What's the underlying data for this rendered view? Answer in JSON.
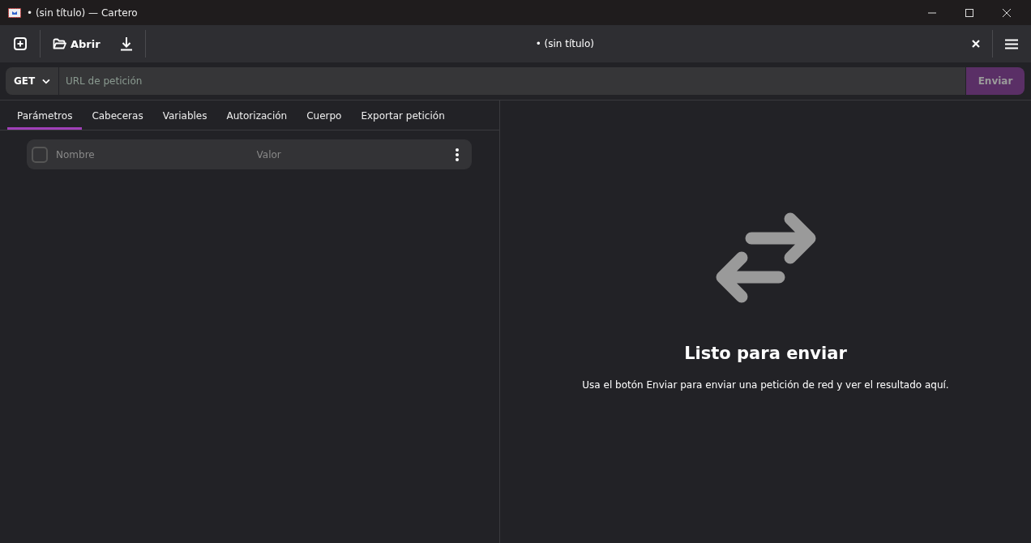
{
  "window": {
    "title": "• (sin título) — Cartero"
  },
  "header": {
    "open_label": "Abrir",
    "document_title": "• (sin título)"
  },
  "request": {
    "method": "GET",
    "url_placeholder": "URL de petición",
    "send_label": "Enviar",
    "send_disabled": true
  },
  "tabs": [
    {
      "label": "Parámetros",
      "selected": true
    },
    {
      "label": "Cabeceras",
      "selected": false
    },
    {
      "label": "Variables",
      "selected": false
    },
    {
      "label": "Autorización",
      "selected": false
    },
    {
      "label": "Cuerpo",
      "selected": false
    },
    {
      "label": "Exportar petición",
      "selected": false
    }
  ],
  "params": [
    {
      "checked": false,
      "name_placeholder": "Nombre",
      "value_placeholder": "Valor"
    }
  ],
  "empty_state": {
    "title": "Listo para enviar",
    "message": "Usa el botón Enviar para enviar una petición de red y ver el resultado aquí."
  }
}
